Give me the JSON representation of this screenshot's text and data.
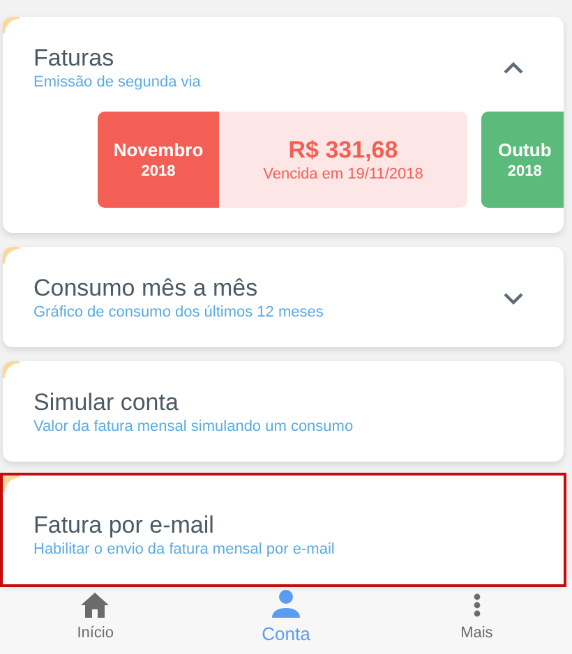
{
  "cards": [
    {
      "kind": "invoices",
      "title": "Faturas",
      "subtitle": "Emissão de segunda via",
      "expanded": true,
      "highlighted": false,
      "invoices": [
        {
          "month": "Novembro",
          "year": "2018",
          "color": "#f45f55",
          "amount": "R$ 331,68",
          "due": "Vencida em 19/11/2018"
        },
        {
          "month": "Outub",
          "year": "2018",
          "color": "#5bbb7b"
        }
      ]
    },
    {
      "kind": "plain",
      "title": "Consumo mês a mês",
      "subtitle": "Gráfico de consumo dos últimos 12 meses",
      "expanded": false,
      "highlighted": false
    },
    {
      "kind": "plain",
      "title": "Simular conta",
      "subtitle": "Valor da fatura mensal simulando um consumo",
      "highlighted": false
    },
    {
      "kind": "plain",
      "title": "Fatura por e-mail",
      "subtitle": "Habilitar o envio da fatura mensal por e-mail",
      "highlighted": true
    }
  ],
  "nav": [
    {
      "label": "Início",
      "selected": false
    },
    {
      "label": "Conta",
      "selected": true
    },
    {
      "label": "Mais",
      "selected": false
    }
  ]
}
